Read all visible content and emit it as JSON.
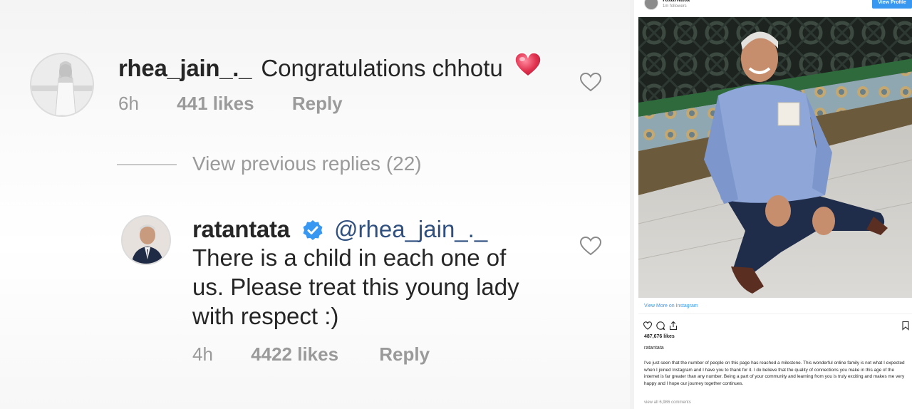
{
  "thread": {
    "comment1": {
      "username": "rhea_jain_._",
      "text": "Congratulations chhotu",
      "time": "6h",
      "likes": "441 likes",
      "reply": "Reply"
    },
    "view_previous": "View previous replies (22)",
    "reply1": {
      "username": "ratantata",
      "mention": "@rhea_jain_._",
      "line1": "There is a child in each one of",
      "line2": "us. Please treat this young lady",
      "line3": "with respect :)",
      "time": "4h",
      "likes": "4422 likes",
      "reply": "Reply"
    }
  },
  "post": {
    "username": "ratantata",
    "followers": "1m followers",
    "view_profile": "View Profile",
    "view_more": "View More on Instagram",
    "likes": "487,676 likes",
    "caption_user": "ratantata",
    "caption": "I've just seen that the number of people on this page has reached a milestone. This wonderful online family is not what I expected when I joined Instagram and I have you to thank for it. I do believe that the quality of connections you make in this age of the internet is far greater than any number. Being a part of your community and learning from you is truly exciting and makes me very happy and I hope our journey together continues.",
    "view_all": "view all 6,986 comments"
  },
  "colors": {
    "instagram_blue": "#3897f0",
    "heart_red": "#e0324f",
    "meta_grey": "#9a9a9a"
  },
  "icons": [
    "heart-emoji-icon",
    "heart-outline-icon",
    "verified-badge-icon",
    "comment-icon",
    "share-icon",
    "bookmark-icon"
  ]
}
